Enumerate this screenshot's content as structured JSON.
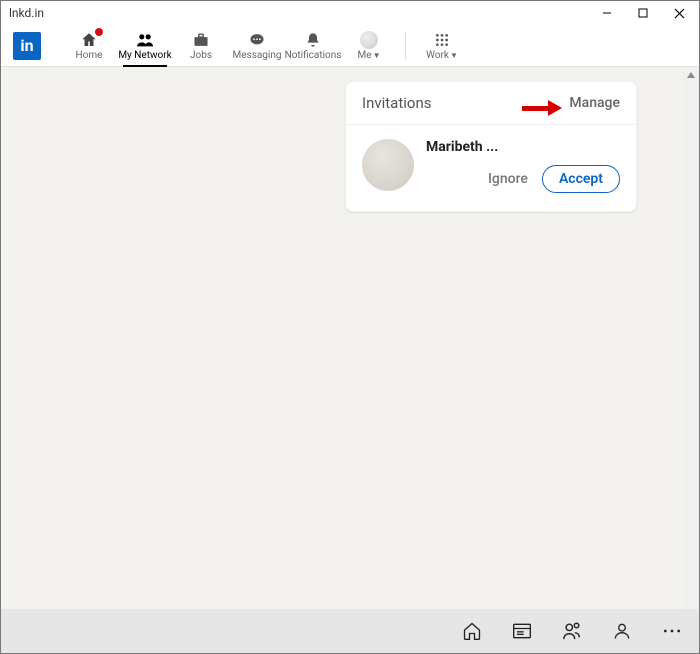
{
  "window": {
    "title": "lnkd.in"
  },
  "logo": {
    "text": "in"
  },
  "nav": {
    "home": "Home",
    "my_network": "My Network",
    "jobs": "Jobs",
    "messaging": "Messaging",
    "notifications": "Notifications",
    "me": "Me",
    "work": "Work"
  },
  "invitations": {
    "title": "Invitations",
    "manage": "Manage",
    "items": [
      {
        "name": "Maribeth ...",
        "ignore": "Ignore",
        "accept": "Accept"
      }
    ]
  }
}
